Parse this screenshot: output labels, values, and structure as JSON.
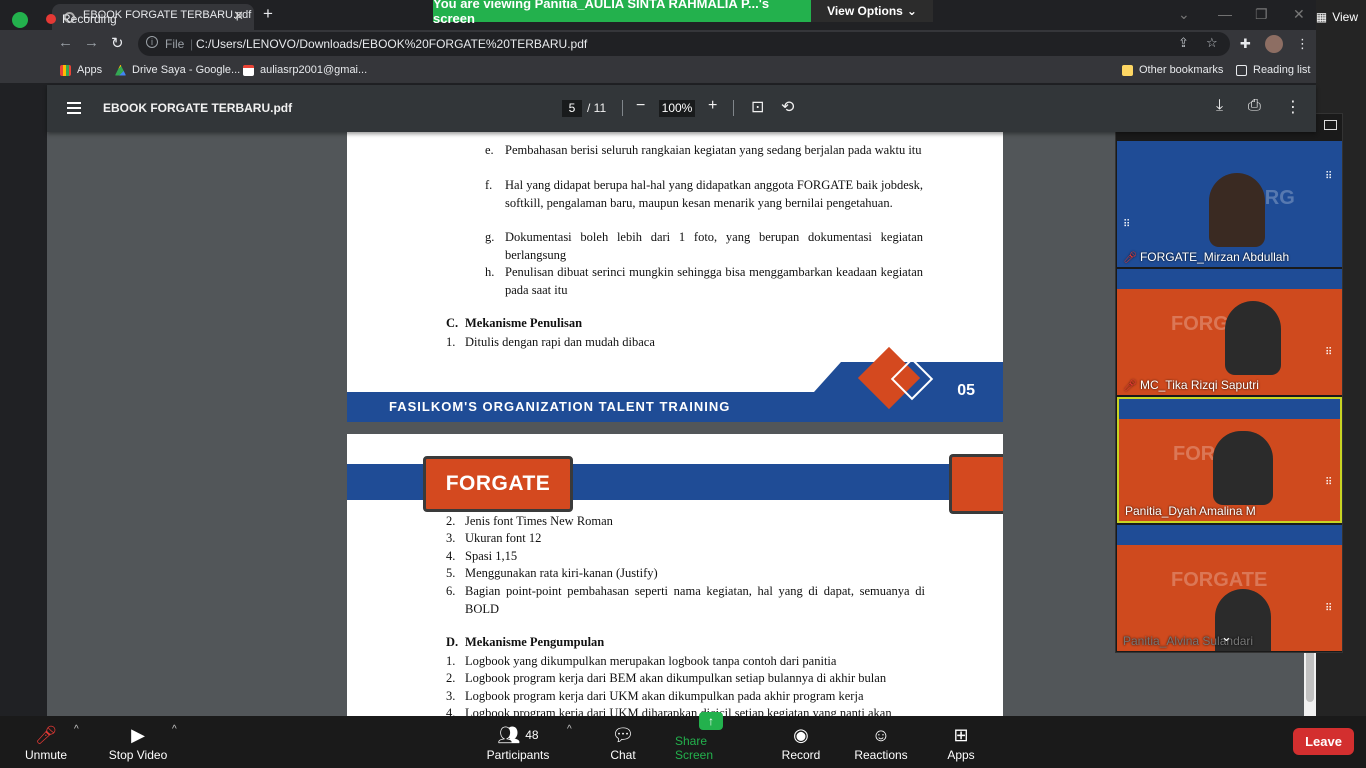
{
  "zoom": {
    "banner_text": "You are viewing Panitia_AULIA SINTA RAHMALIA P...'s screen",
    "view_options_label": "View Options",
    "view_label": "View",
    "recording_label": "Recording",
    "colors": {
      "banner_green": "#23b14d",
      "leave_red": "#d32f2f",
      "active_speaker": "#c8d423"
    }
  },
  "browser": {
    "tab_title": "EBOOK FORGATE TERBARU.pdf",
    "address_prefix": "File",
    "url": "C:/Users/LENOVO/Downloads/EBOOK%20FORGATE%20TERBARU.pdf",
    "bookmarks": [
      {
        "label": "Apps",
        "icon": "apps-grid-icon"
      },
      {
        "label": "Drive Saya - Google...",
        "icon": "google-drive-icon"
      },
      {
        "label": "auliasrp2001@gmai...",
        "icon": "gmail-icon"
      }
    ],
    "other_bookmarks": "Other bookmarks",
    "reading_list": "Reading list"
  },
  "pdf": {
    "title": "EBOOK FORGATE TERBARU.pdf",
    "current_page": "5",
    "total_pages": "/ 11",
    "zoom": "100%",
    "page1": {
      "items": [
        {
          "marker": "e.",
          "text": "Pembahasan berisi seluruh rangkaian kegiatan yang sedang berjalan pada waktu itu"
        },
        {
          "marker": "f.",
          "text": "Hal yang didapat berupa hal-hal yang didapatkan anggota FORGATE baik jobdesk, softkill, pengalaman baru, maupun kesan menarik yang bernilai pengetahuan."
        },
        {
          "marker": "g.",
          "text": "Dokumentasi boleh lebih dari 1 foto, yang berupan dokumentasi kegiatan berlangsung"
        },
        {
          "marker": "h.",
          "text": "Penulisan dibuat serinci mungkin sehingga bisa menggambarkan keadaan kegiatan pada saat itu"
        }
      ],
      "section_c": "C.",
      "section_c_title": "Mekanisme Penulisan",
      "c_items": [
        {
          "marker": "1.",
          "text": "Ditulis dengan rapi dan mudah dibaca"
        }
      ],
      "footer_text": "FASILKOM'S ORGANIZATION TALENT TRAINING",
      "page_number": "05"
    },
    "page2": {
      "header_logo": "FORGATE",
      "items": [
        {
          "marker": "2.",
          "text": "Jenis font Times New Roman"
        },
        {
          "marker": "3.",
          "text": "Ukuran font 12"
        },
        {
          "marker": "4.",
          "text": "Spasi 1,15"
        },
        {
          "marker": "5.",
          "text": "Menggunakan rata kiri-kanan (Justify)"
        },
        {
          "marker": "6.",
          "text": "Bagian point-point pembahasan seperti nama kegiatan, hal yang di dapat, semuanya di BOLD"
        }
      ],
      "section_d": "D.",
      "section_d_title": "Mekanisme Pengumpulan",
      "d_items": [
        {
          "marker": "1.",
          "text": "Logbook yang dikumpulkan merupakan logbook tanpa contoh dari panitia"
        },
        {
          "marker": "2.",
          "text": "Logbook program kerja dari BEM akan dikumpulkan setiap bulannya di akhir bulan"
        },
        {
          "marker": "3.",
          "text": "Logbook program kerja dari UKM akan dikumpulkan pada akhir program kerja"
        },
        {
          "marker": "4.",
          "text": "Logbook program kerja dari UKM diharapkan dicicil setiap kegiatan yang nanti akan"
        }
      ]
    }
  },
  "gallery": {
    "participants": [
      {
        "name": "FORGATE_Mirzan Abdullah",
        "muted": true,
        "bg": "#1f4c96"
      },
      {
        "name": "MC_Tika Rizqi Saputri",
        "muted": true,
        "bg": "#cf4a1e"
      },
      {
        "name": "Panitia_Dyah Amalina M",
        "muted": false,
        "bg": "#cf4a1e"
      },
      {
        "name": "Panitia_Alvina Sulandari",
        "muted": false,
        "bg": "#cf4a1e"
      }
    ]
  },
  "controls": {
    "unmute": "Unmute",
    "stop_video": "Stop Video",
    "participants": "Participants",
    "participant_count": "48",
    "chat": "Chat",
    "share_screen": "Share Screen",
    "record": "Record",
    "reactions": "Reactions",
    "apps": "Apps",
    "leave": "Leave"
  }
}
